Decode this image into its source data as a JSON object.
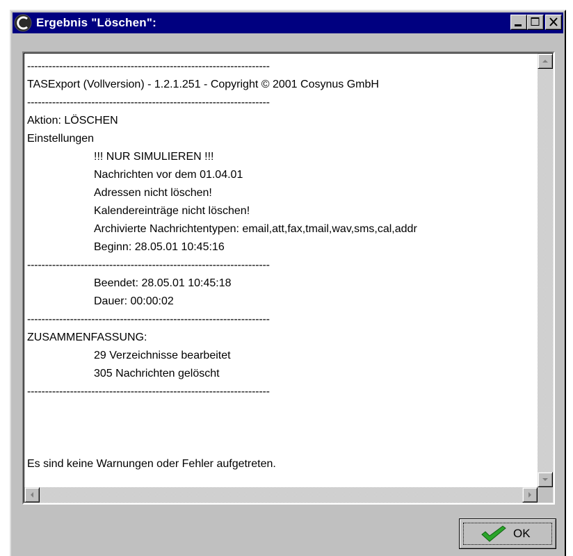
{
  "window": {
    "title": "Ergebnis \"Löschen\":"
  },
  "log": {
    "lines": [
      {
        "text": "--------------------------------------------------------------------",
        "indent": false,
        "sep": true
      },
      {
        "text": "TASExport (Vollversion) - 1.2.1.251 - Copyright © 2001 Cosynus GmbH",
        "indent": false,
        "sep": false
      },
      {
        "text": "--------------------------------------------------------------------",
        "indent": false,
        "sep": true
      },
      {
        "text": "Aktion: LÖSCHEN",
        "indent": false,
        "sep": false
      },
      {
        "text": "Einstellungen",
        "indent": false,
        "sep": false
      },
      {
        "text": "!!! NUR SIMULIEREN !!!",
        "indent": true,
        "sep": false
      },
      {
        "text": "Nachrichten vor dem 01.04.01",
        "indent": true,
        "sep": false
      },
      {
        "text": "Adressen nicht löschen!",
        "indent": true,
        "sep": false
      },
      {
        "text": "Kalendereinträge nicht löschen!",
        "indent": true,
        "sep": false
      },
      {
        "text": "Archivierte Nachrichtentypen: email,att,fax,tmail,wav,sms,cal,addr",
        "indent": true,
        "sep": false
      },
      {
        "text": "Beginn: 28.05.01 10:45:16",
        "indent": true,
        "sep": false
      },
      {
        "text": "--------------------------------------------------------------------",
        "indent": false,
        "sep": true
      },
      {
        "text": "Beendet: 28.05.01 10:45:18",
        "indent": true,
        "sep": false
      },
      {
        "text": "Dauer: 00:00:02",
        "indent": true,
        "sep": false
      },
      {
        "text": "--------------------------------------------------------------------",
        "indent": false,
        "sep": true
      },
      {
        "text": "ZUSAMMENFASSUNG:",
        "indent": false,
        "sep": false
      },
      {
        "text": "29 Verzeichnisse bearbeitet",
        "indent": true,
        "sep": false
      },
      {
        "text": "305 Nachrichten gelöscht",
        "indent": true,
        "sep": false
      },
      {
        "text": "--------------------------------------------------------------------",
        "indent": false,
        "sep": true
      },
      {
        "text": "",
        "indent": false,
        "sep": false
      },
      {
        "text": "",
        "indent": false,
        "sep": false
      },
      {
        "text": "",
        "indent": false,
        "sep": false
      },
      {
        "text": "Es sind keine Warnungen oder Fehler aufgetreten.",
        "indent": false,
        "sep": false
      }
    ]
  },
  "ok_button": {
    "label": "OK"
  },
  "colors": {
    "titlebar": "#000080",
    "face": "#c0c0c0",
    "check": "#20a020"
  }
}
